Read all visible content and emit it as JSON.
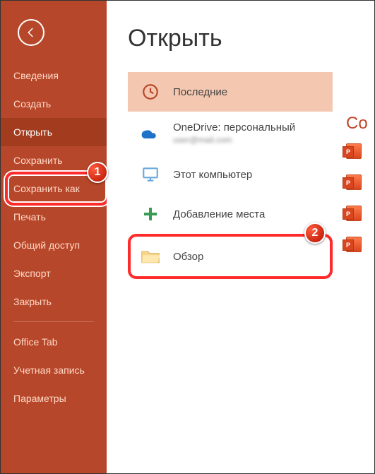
{
  "sidebar": {
    "items": [
      {
        "label": "Сведения"
      },
      {
        "label": "Создать"
      },
      {
        "label": "Открыть"
      },
      {
        "label": "Сохранить"
      },
      {
        "label": "Сохранить как"
      },
      {
        "label": "Печать"
      },
      {
        "label": "Общий доступ"
      },
      {
        "label": "Экспорт"
      },
      {
        "label": "Закрыть"
      }
    ],
    "footer": [
      {
        "label": "Office Tab"
      },
      {
        "label": "Учетная запись"
      },
      {
        "label": "Параметры"
      }
    ]
  },
  "main": {
    "title": "Открыть",
    "locations": [
      {
        "label": "Последние"
      },
      {
        "label": "OneDrive: персональный",
        "sub": "user@mail.com"
      },
      {
        "label": "Этот компьютер"
      },
      {
        "label": "Добавление места"
      },
      {
        "label": "Обзор"
      }
    ],
    "right_header_fragment": "Со"
  },
  "annotations": {
    "badge1": "1",
    "badge2": "2"
  }
}
